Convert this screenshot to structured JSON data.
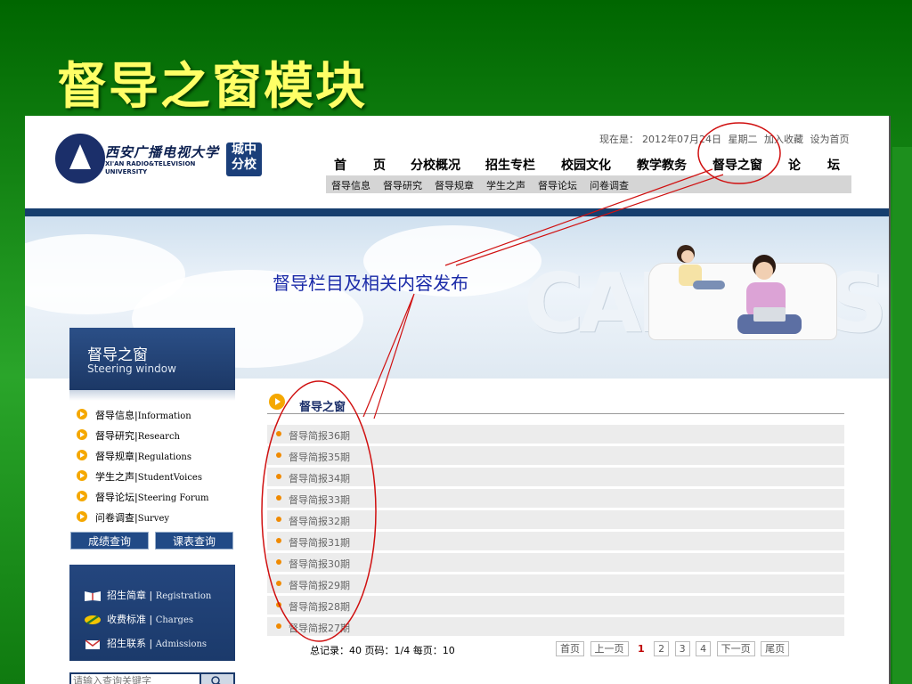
{
  "slide": {
    "title": "督导之窗模块"
  },
  "header": {
    "logo_cn": "西安广播电视大学",
    "logo_en_line1": "XI'AN RADIO&TELEVISION",
    "logo_en_line2": "UNIVERSITY",
    "branch": [
      "城中",
      "分校"
    ],
    "date_label": "现在是：",
    "date_value": "2012年07月24日",
    "weekday": "星期二",
    "add_favorite": "加入收藏",
    "set_home": "设为首页"
  },
  "nav": {
    "items": [
      "首",
      "页",
      "分校概况",
      "招生专栏",
      "校园文化",
      "教学教务",
      "督导之窗",
      "论",
      "坛"
    ]
  },
  "subnav": {
    "items": [
      "督导信息",
      "督导研究",
      "督导规章",
      "学生之声",
      "督导论坛",
      "问卷调查"
    ]
  },
  "banner": {
    "caption": "督导栏目及相关内容发布",
    "campus_word": "CAMPUS"
  },
  "sidebar": {
    "title": "督导之窗",
    "subtitle": "Steering window",
    "items": [
      {
        "cn": "督导信息",
        "en": "Information"
      },
      {
        "cn": "督导研究",
        "en": "Research"
      },
      {
        "cn": "督导规章",
        "en": "Regulations"
      },
      {
        "cn": "学生之声",
        "en": "StudentVoices"
      },
      {
        "cn": "督导论坛",
        "en": "Steering Forum"
      },
      {
        "cn": "问卷调查",
        "en": "Survey"
      }
    ],
    "grade_query": "成绩查询",
    "schedule_query": "课表查询",
    "links": [
      {
        "cn": "招生简章",
        "en": "Registration",
        "icon": "book-icon"
      },
      {
        "cn": "收费标准",
        "en": "Charges",
        "icon": "pencil-icon"
      },
      {
        "cn": "招生联系",
        "en": "Admissions",
        "icon": "envelope-icon"
      }
    ],
    "search_placeholder": "请输入查询关键字"
  },
  "content": {
    "section_title": "督导之窗",
    "news": [
      "督导简报36期",
      "督导简报35期",
      "督导简报34期",
      "督导简报33期",
      "督导简报32期",
      "督导简报31期",
      "督导简报30期",
      "督导简报29期",
      "督导简报28期",
      "督导简报27期"
    ],
    "stats": "总记录：40 页码：1/4 每页：10",
    "pager": {
      "first": "首页",
      "prev": "上一页",
      "pages": [
        "1",
        "2",
        "3",
        "4"
      ],
      "current": "1",
      "next": "下一页",
      "last": "尾页"
    }
  },
  "colors": {
    "slide_bg": "#1a8a1a",
    "title_yellow": "#ffff66",
    "navy": "#1b3a6b",
    "annotation_red": "#d01010",
    "caption_blue": "#1a2aa8"
  }
}
